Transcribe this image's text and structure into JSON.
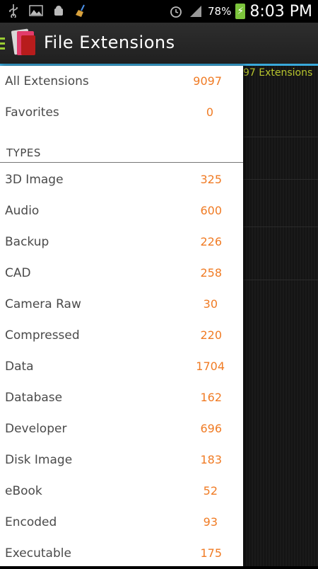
{
  "status": {
    "battery_pct": "78%",
    "time": "8:03 PM"
  },
  "header": {
    "title": "File Extensions"
  },
  "background": {
    "count_text": "97 Extensions"
  },
  "drawer": {
    "top_items": [
      {
        "label": "All Extensions",
        "count": "9097"
      },
      {
        "label": "Favorites",
        "count": "0"
      }
    ],
    "section_title": "TYPES",
    "types": [
      {
        "label": "3D Image",
        "count": "325"
      },
      {
        "label": "Audio",
        "count": "600"
      },
      {
        "label": "Backup",
        "count": "226"
      },
      {
        "label": "CAD",
        "count": "258"
      },
      {
        "label": "Camera Raw",
        "count": "30"
      },
      {
        "label": "Compressed",
        "count": "220"
      },
      {
        "label": "Data",
        "count": "1704"
      },
      {
        "label": "Database",
        "count": "162"
      },
      {
        "label": "Developer",
        "count": "696"
      },
      {
        "label": "Disk Image",
        "count": "183"
      },
      {
        "label": "eBook",
        "count": "52"
      },
      {
        "label": "Encoded",
        "count": "93"
      },
      {
        "label": "Executable",
        "count": "175"
      }
    ]
  },
  "colors": {
    "accent": "#39a9db",
    "count": "#f07b24",
    "hamburger": "#9acd32"
  }
}
